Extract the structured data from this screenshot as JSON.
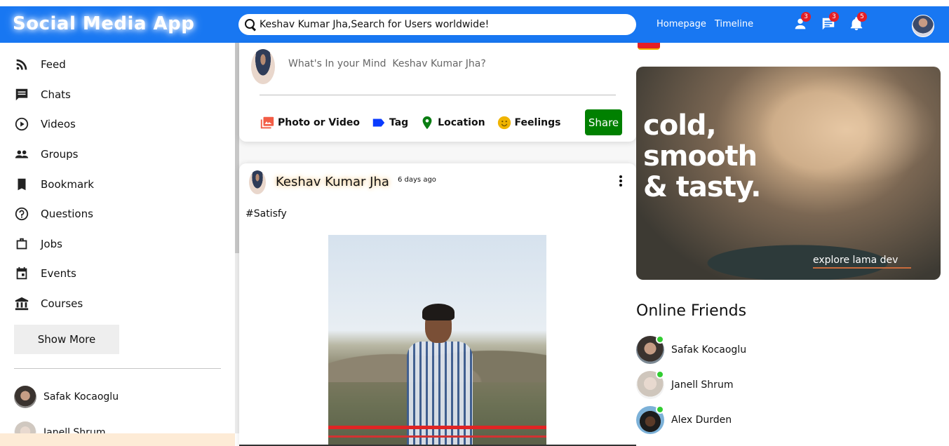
{
  "header": {
    "logo": "Social Media App",
    "search_placeholder": "Keshav Kumar Jha,Search for Users worldwide!",
    "links": [
      "Homepage",
      "Timeline"
    ],
    "badges": {
      "friend_requests": "3",
      "messages": "3",
      "notifications": "5"
    },
    "accent_color": "#1877f2"
  },
  "sidebar": {
    "items": [
      {
        "label": "Feed",
        "icon": "rss-feed-icon"
      },
      {
        "label": "Chats",
        "icon": "chat-icon"
      },
      {
        "label": "Videos",
        "icon": "play-circle-icon"
      },
      {
        "label": "Groups",
        "icon": "group-icon"
      },
      {
        "label": "Bookmark",
        "icon": "bookmark-icon"
      },
      {
        "label": "Questions",
        "icon": "help-icon"
      },
      {
        "label": "Jobs",
        "icon": "briefcase-icon"
      },
      {
        "label": "Events",
        "icon": "calendar-icon"
      },
      {
        "label": "Courses",
        "icon": "school-icon"
      }
    ],
    "show_more": "Show More",
    "friends": [
      "Safak Kocaoglu",
      "Janell Shrum"
    ]
  },
  "share": {
    "placeholder": "What's In your Mind  Keshav Kumar Jha?",
    "options": [
      "Photo or Video",
      "Tag",
      "Location",
      "Feelings"
    ],
    "share_button": "Share"
  },
  "post": {
    "username": "Keshav Kumar Jha",
    "time": "6 days ago",
    "text": "#Satisfy"
  },
  "rightbar": {
    "ad_headline": [
      "cold,",
      "smooth",
      "& tasty."
    ],
    "ad_sub": "explore lama dev",
    "online_title": "Online Friends",
    "online_friends": [
      "Safak Kocaoglu",
      "Janell Shrum",
      "Alex Durden"
    ],
    "online_color": "#32cd32"
  }
}
